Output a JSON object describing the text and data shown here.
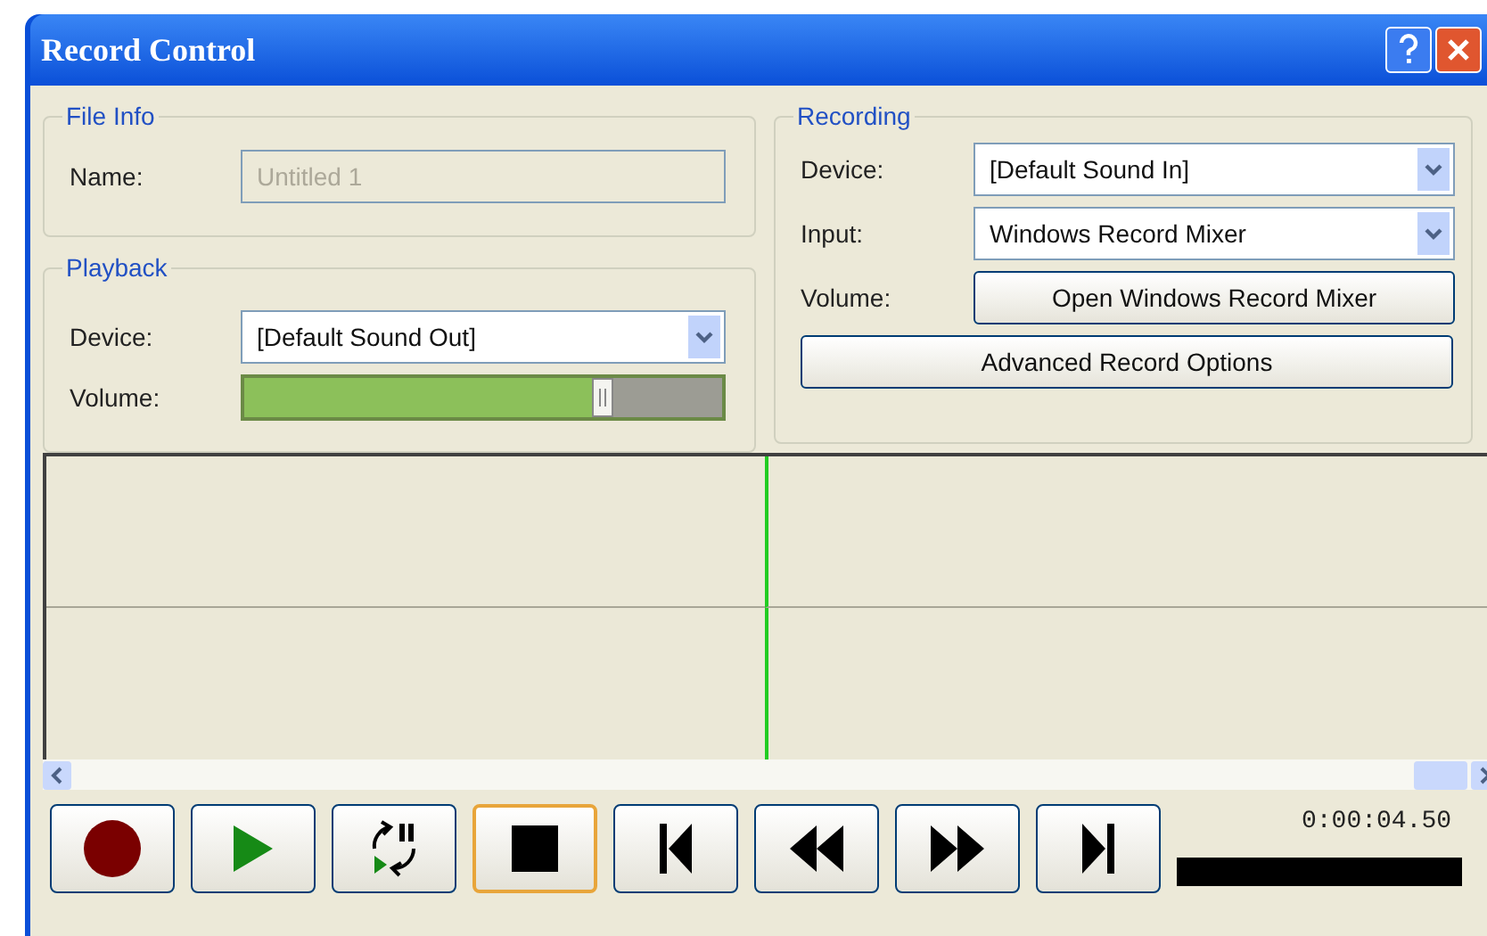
{
  "window": {
    "title": "Record Control"
  },
  "file_info": {
    "title": "File Info",
    "name_label": "Name:",
    "name_value": "Untitled 1",
    "disabled": true
  },
  "playback": {
    "title": "Playback",
    "device_label": "Device:",
    "device_value": "[Default Sound Out]",
    "volume_label": "Volume:",
    "volume": {
      "level": 0.75
    }
  },
  "recording": {
    "title": "Recording",
    "device_label": "Device:",
    "device_value": "[Default Sound In]",
    "input_label": "Input:",
    "input_value": "Windows Record Mixer",
    "volume_label": "Volume:",
    "mixer_button": "Open Windows Record Mixer",
    "advanced_button": "Advanced Record Options"
  },
  "transport": [
    {
      "kind": "record",
      "focused": false
    },
    {
      "kind": "play",
      "focused": false
    },
    {
      "kind": "loop",
      "focused": false
    },
    {
      "kind": "stop",
      "focused": true
    },
    {
      "kind": "start",
      "focused": false
    },
    {
      "kind": "rewind",
      "focused": false
    },
    {
      "kind": "forward",
      "focused": false
    },
    {
      "kind": "end",
      "focused": false
    }
  ],
  "time": "0:00:04.50"
}
